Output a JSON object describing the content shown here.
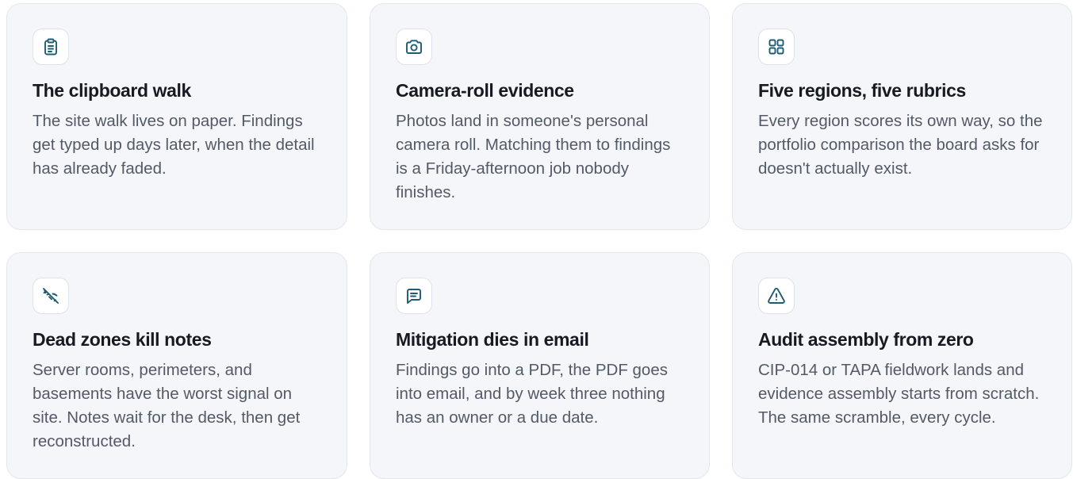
{
  "colors": {
    "card_bg": "#f4f6fa",
    "card_border": "#e3e7ee",
    "icon_accent": "#1c5d73",
    "title": "#161a21",
    "body": "#535a66"
  },
  "cards": [
    {
      "icon": "clipboard-icon",
      "title": "The clipboard walk",
      "body": "The site walk lives on paper. Findings get typed up days later, when the detail has already faded."
    },
    {
      "icon": "camera-icon",
      "title": "Camera-roll evidence",
      "body": "Photos land in someone's personal camera roll. Matching them to findings is a Friday-afternoon job nobody finishes."
    },
    {
      "icon": "grid-icon",
      "title": "Five regions, five rubrics",
      "body": "Every region scores its own way, so the portfolio comparison the board asks for doesn't actually exist."
    },
    {
      "icon": "no-signal-icon",
      "title": "Dead zones kill notes",
      "body": "Server rooms, perimeters, and basements have the worst signal on site. Notes wait for the desk, then get reconstructed."
    },
    {
      "icon": "message-icon",
      "title": "Mitigation dies in email",
      "body": "Findings go into a PDF, the PDF goes into email, and by week three nothing has an owner or a due date."
    },
    {
      "icon": "warning-icon",
      "title": "Audit assembly from zero",
      "body": "CIP-014 or TAPA fieldwork lands and evidence assembly starts from scratch. The same scramble, every cycle."
    }
  ]
}
